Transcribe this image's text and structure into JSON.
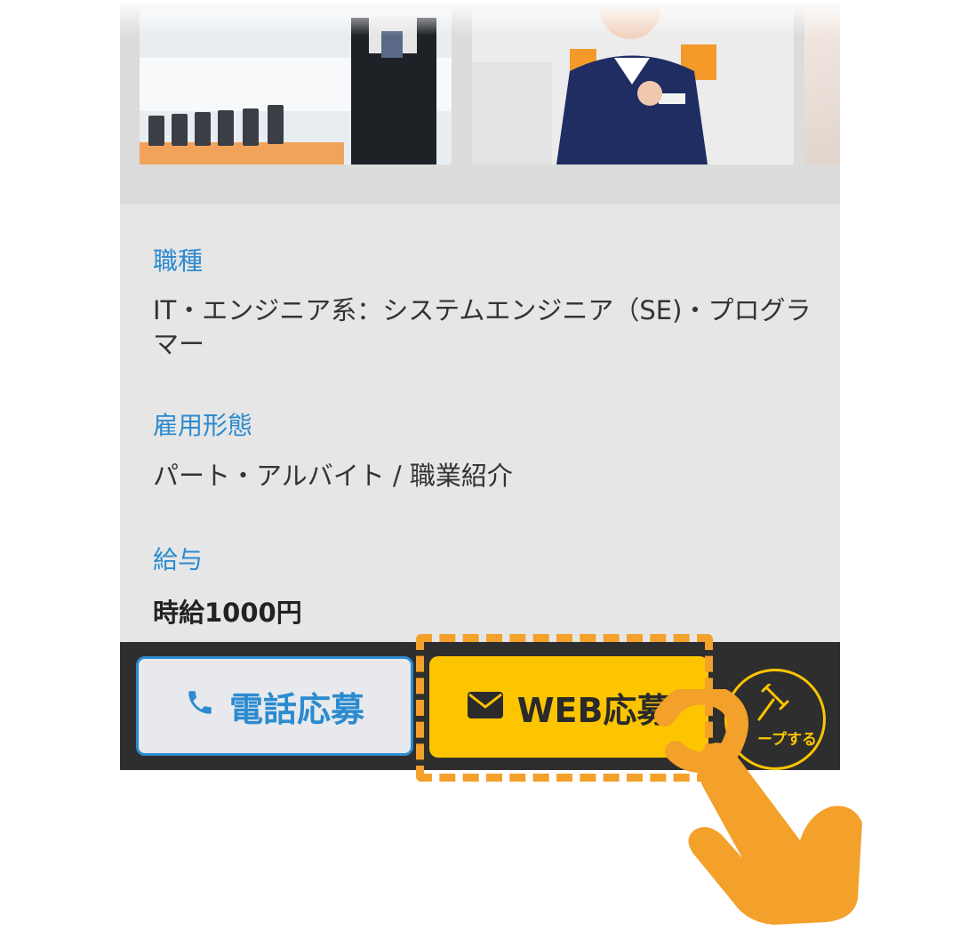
{
  "details": {
    "job_type_label": "職種",
    "job_type_value": "IT・エンジニア系：システムエンジニア（SE)・プログラマー",
    "employment_label": "雇用形態",
    "employment_value": "パート・アルバイト / 職業紹介",
    "salary_label": "給与",
    "salary_value": "時給1000円"
  },
  "actions": {
    "call_label": "電話応募",
    "web_label": "WEB応募",
    "keep_label": "ープする"
  },
  "icons": {
    "call": "phone-icon",
    "web": "envelope-icon",
    "keep": "pin-icon",
    "pointer": "hand-pointer-icon"
  },
  "colors": {
    "accent_blue": "#2c8bd0",
    "web_yellow": "#fdc500",
    "highlight_orange": "#f3a12a",
    "bar_dark": "#2e2e2e"
  }
}
